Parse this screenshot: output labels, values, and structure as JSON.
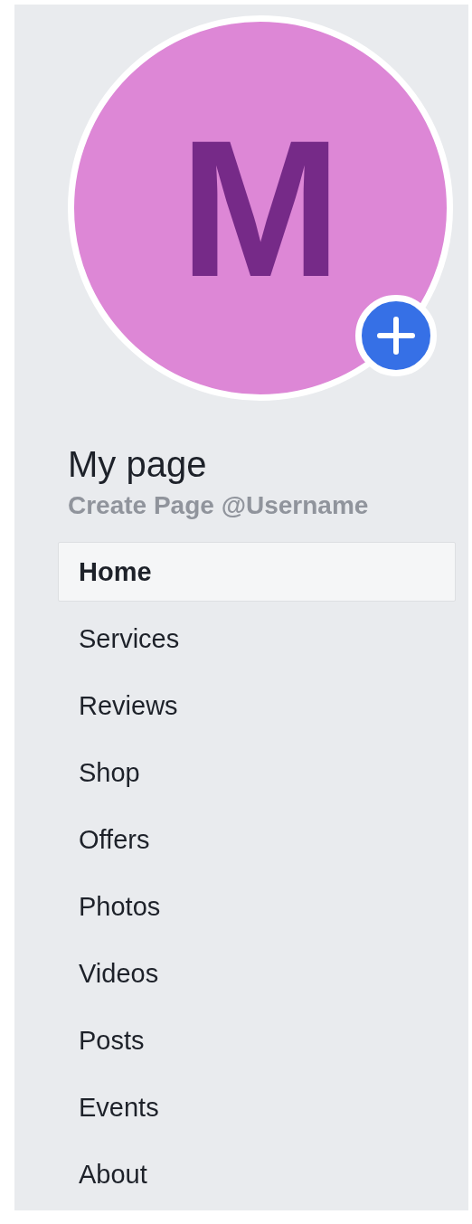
{
  "avatar": {
    "initial": "M"
  },
  "page": {
    "title": "My page",
    "username": "Create Page @Username"
  },
  "nav": [
    {
      "label": "Home",
      "selected": true
    },
    {
      "label": "Services",
      "selected": false
    },
    {
      "label": "Reviews",
      "selected": false
    },
    {
      "label": "Shop",
      "selected": false
    },
    {
      "label": "Offers",
      "selected": false
    },
    {
      "label": "Photos",
      "selected": false
    },
    {
      "label": "Videos",
      "selected": false
    },
    {
      "label": "Posts",
      "selected": false
    },
    {
      "label": "Events",
      "selected": false
    },
    {
      "label": "About",
      "selected": false
    }
  ]
}
